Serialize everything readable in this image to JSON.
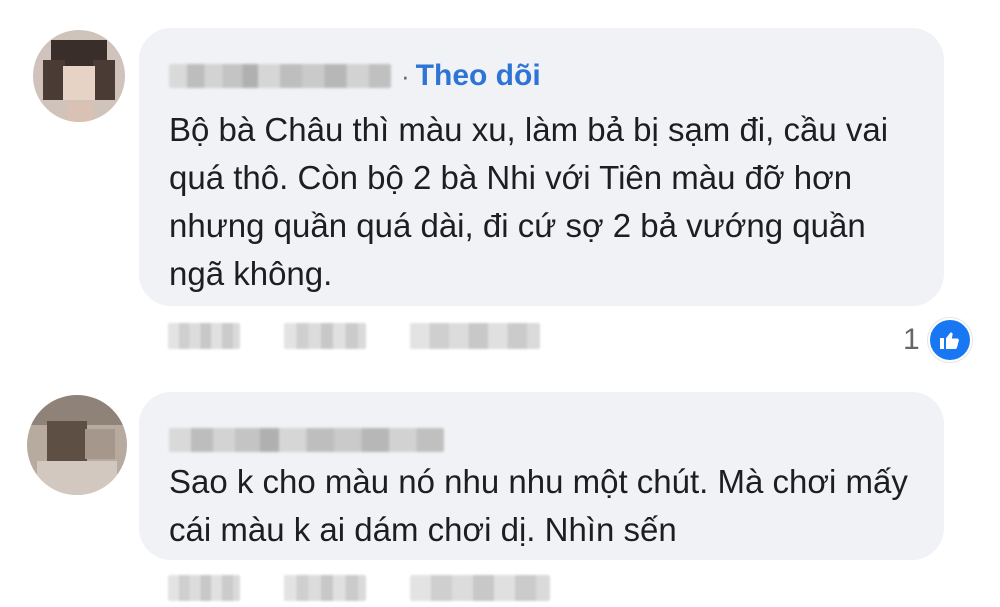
{
  "colors": {
    "bubble_background": "#f0f2f5",
    "follow_link": "#2e74d4",
    "comment_text": "#1c1e21",
    "secondary_text": "#65676b",
    "like_blue": "#1877f2"
  },
  "comments": [
    {
      "author_name": "",
      "separator": "·",
      "follow_label": "Theo dõi",
      "text": "Bộ bà Châu thì màu xu, làm bả bị sạm đi, cầu vai quá thô. Còn bộ 2 bà Nhi với Tiên màu đỡ hơn nhưng quần quá dài, đi cứ sợ 2 bả vướng quần ngã không.",
      "reaction_count": "1",
      "reaction_icon": "like-icon"
    },
    {
      "author_name": "",
      "text": "Sao k cho màu nó nhu nhu một chút. Mà chơi mấy cái màu k ai dám chơi dị. Nhìn sến"
    }
  ]
}
